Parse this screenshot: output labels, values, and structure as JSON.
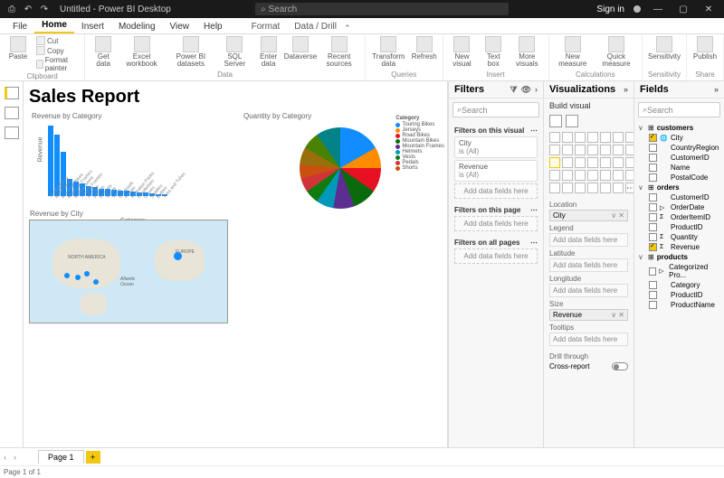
{
  "window": {
    "title": "Untitled - Power BI Desktop",
    "search_placeholder": "Search",
    "signin": "Sign in"
  },
  "menutabs": [
    "File",
    "Home",
    "Insert",
    "Modeling",
    "View",
    "Help"
  ],
  "ctxtabs": [
    "Format",
    "Data / Drill"
  ],
  "active_tab": "Home",
  "ribbon": {
    "clipboard": {
      "label": "Clipboard",
      "paste": "Paste",
      "cut": "Cut",
      "copy": "Copy",
      "fmt": "Format painter"
    },
    "data": {
      "label": "Data",
      "items": [
        "Get data",
        "Excel workbook",
        "Power BI datasets",
        "SQL Server",
        "Enter data",
        "Dataverse",
        "Recent sources"
      ]
    },
    "queries": {
      "label": "Queries",
      "items": [
        "Transform data",
        "Refresh"
      ]
    },
    "insert": {
      "label": "Insert",
      "items": [
        "New visual",
        "Text box",
        "More visuals"
      ]
    },
    "calc": {
      "label": "Calculations",
      "items": [
        "New measure",
        "Quick measure"
      ]
    },
    "sens": {
      "label": "Sensitivity",
      "items": [
        "Sensitivity"
      ]
    },
    "share": {
      "label": "Share",
      "items": [
        "Publish"
      ]
    }
  },
  "report": {
    "title": "Sales Report"
  },
  "chart_data": [
    {
      "type": "bar",
      "title": "Revenue by Category",
      "xlabel": "Category",
      "ylabel": "Revenue",
      "ylim": [
        0,
        250000
      ],
      "categories": [
        "Touring Bikes",
        "Road Bikes",
        "Mountain Bikes",
        "Mountain Frames",
        "Road Frames",
        "Touring Frames",
        "Jerseys",
        "Wheels",
        "Helmets",
        "Shorts",
        "Vests",
        "Cranksets",
        "Pedals",
        "Hydration Packs",
        "Handlebars",
        "Gloves",
        "Saddles",
        "Bottles",
        "Tires and Tubes"
      ],
      "values": [
        240000,
        210000,
        150000,
        60000,
        48000,
        42000,
        35000,
        30000,
        26000,
        24000,
        21000,
        19000,
        17000,
        15000,
        13000,
        11000,
        9000,
        7000,
        5000
      ]
    },
    {
      "type": "pie",
      "title": "Quantity by Category",
      "legend_title": "Category",
      "series": [
        {
          "name": "Touring Bikes",
          "value": 252,
          "pct": 17.07,
          "color": "#118dff"
        },
        {
          "name": "Jerseys",
          "value": 50,
          "pct": 3.39,
          "color": "#ff8c00"
        },
        {
          "name": "Road Bikes",
          "value": 84,
          "pct": 5.69,
          "color": "#e81123"
        },
        {
          "name": "Mountain Bikes",
          "value": 222,
          "pct": 15.04,
          "color": "#0b6a0b"
        },
        {
          "name": "Mountain Frames",
          "value": 60,
          "pct": 4.07,
          "color": "#5c2e91"
        },
        {
          "name": "Helmets",
          "value": 222,
          "pct": 15.04,
          "color": "#0099bc"
        },
        {
          "name": "Vests",
          "value": 209,
          "pct": 14.16,
          "color": "#107c10"
        },
        {
          "name": "Pedals",
          "value": 129,
          "pct": 8.74,
          "color": "#d13438"
        },
        {
          "name": "Shorts",
          "value": 120,
          "pct": 8.13,
          "color": "#ca5010"
        },
        {
          "name": "",
          "value": 171,
          "pct": 11.59,
          "color": "#986f0b"
        },
        {
          "name": "",
          "value": 84,
          "pct": 5.69,
          "color": "#498205"
        },
        {
          "name": "",
          "value": 59,
          "pct": 4.0,
          "color": "#038387"
        },
        {
          "name": "",
          "value": 52,
          "pct": 3.52,
          "color": "#744da9"
        },
        {
          "name": "",
          "value": 50,
          "pct": 3.39,
          "color": "#c30052"
        },
        {
          "name": "",
          "value": 46,
          "pct": 3.12,
          "color": "#881798"
        },
        {
          "name": "",
          "value": 44,
          "pct": 2.98,
          "color": "#4a5459"
        }
      ]
    },
    {
      "type": "map",
      "title": "Revenue by City"
    }
  ],
  "filters": {
    "header": "Filters",
    "search_placeholder": "Search",
    "on_visual": {
      "label": "Filters on this visual",
      "cards": [
        {
          "name": "City",
          "state": "is (All)"
        },
        {
          "name": "Revenue",
          "state": "is (All)"
        }
      ],
      "add": "Add data fields here"
    },
    "on_page": {
      "label": "Filters on this page",
      "add": "Add data fields here"
    },
    "on_all": {
      "label": "Filters on all pages",
      "add": "Add data fields here"
    }
  },
  "viz": {
    "header": "Visualizations",
    "build": "Build visual",
    "wells": [
      {
        "label": "Location",
        "value": "City"
      },
      {
        "label": "Legend",
        "value": null,
        "empty": "Add data fields here"
      },
      {
        "label": "Latitude",
        "value": null,
        "empty": "Add data fields here"
      },
      {
        "label": "Longitude",
        "value": null,
        "empty": "Add data fields here"
      },
      {
        "label": "Size",
        "value": "Revenue"
      },
      {
        "label": "Tooltips",
        "value": null,
        "empty": "Add data fields here"
      }
    ],
    "drill": "Drill through",
    "cross": "Cross-report"
  },
  "fields": {
    "header": "Fields",
    "search_placeholder": "Search",
    "tables": [
      {
        "name": "customers",
        "expanded": true,
        "fields": [
          {
            "name": "City",
            "checked": true,
            "geo": true
          },
          {
            "name": "CountryRegion",
            "checked": false
          },
          {
            "name": "CustomerID",
            "checked": false
          },
          {
            "name": "Name",
            "checked": false
          },
          {
            "name": "PostalCode",
            "checked": false
          }
        ]
      },
      {
        "name": "orders",
        "expanded": true,
        "fields": [
          {
            "name": "CustomerID",
            "checked": false
          },
          {
            "name": "OrderDate",
            "checked": false,
            "hier": true
          },
          {
            "name": "OrderItemID",
            "checked": false,
            "sum": true
          },
          {
            "name": "ProductID",
            "checked": false
          },
          {
            "name": "Quantity",
            "checked": false,
            "sum": true
          },
          {
            "name": "Revenue",
            "checked": true,
            "sum": true
          }
        ]
      },
      {
        "name": "products",
        "expanded": true,
        "fields": [
          {
            "name": "Categorized Pro...",
            "checked": false,
            "hier": true
          },
          {
            "name": "Category",
            "checked": false
          },
          {
            "name": "ProductID",
            "checked": false
          },
          {
            "name": "ProductName",
            "checked": false
          }
        ]
      }
    ]
  },
  "pages": {
    "tab": "Page 1",
    "status": "Page 1 of 1",
    "prev": "‹",
    "next": "›"
  }
}
